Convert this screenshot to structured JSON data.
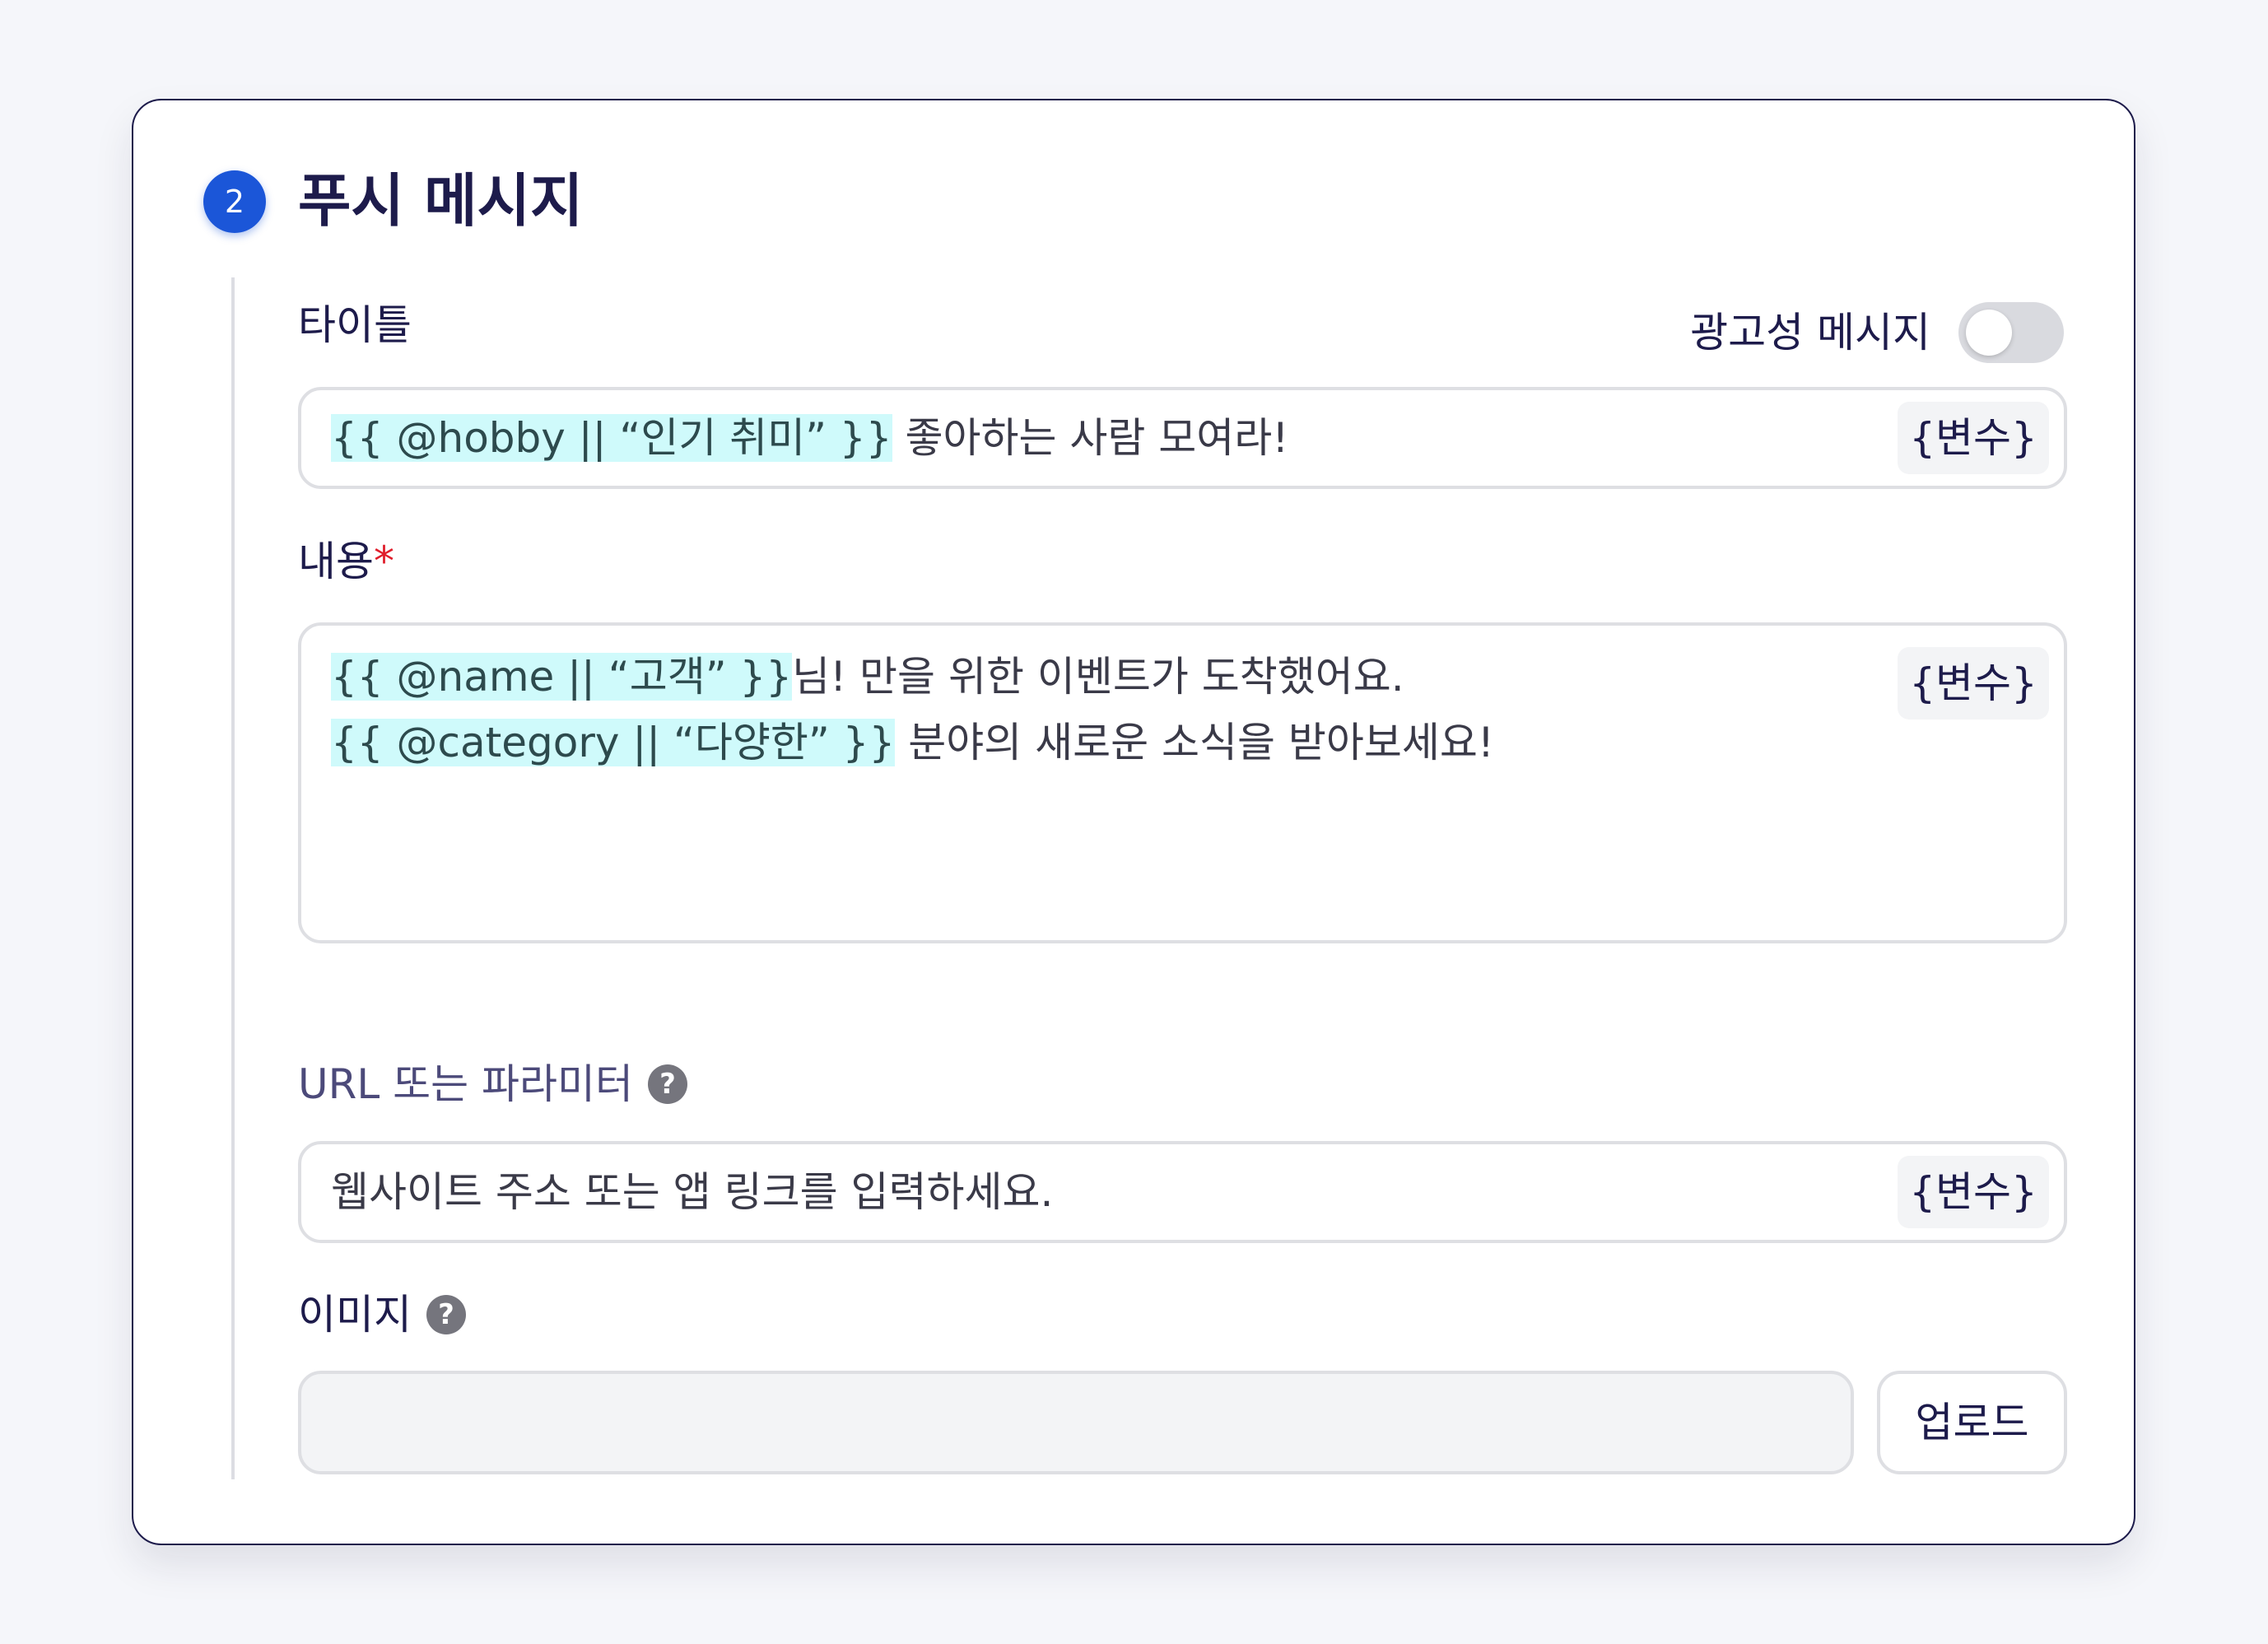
{
  "section": {
    "step_number": "2",
    "title": "푸시 메시지"
  },
  "title_field": {
    "label": "타이틀",
    "variable_chip": "{{ @hobby || “인기 취미” }}",
    "text": " 좋아하는 사람 모여라!",
    "variable_button": "{변수}"
  },
  "ad_toggle": {
    "label": "광고성 메시지",
    "on": false
  },
  "content_field": {
    "label": "내용",
    "required_mark": "*",
    "line1_chip": "{{ @name || “고객” }}",
    "line1_text": "님! 만을 위한 이벤트가 도착했어요.",
    "line2_chip": "{{ @category || “다양한” }}",
    "line2_text": " 분야의 새로운 소식을 받아보세요!",
    "variable_button": "{변수}"
  },
  "url_field": {
    "label": "URL 또는 파라미터",
    "help_icon": "question-circle-icon",
    "placeholder": "웹사이트 주소 또는 앱 링크를 입력하세요.",
    "variable_button": "{변수}"
  },
  "image_field": {
    "label": "이미지",
    "help_icon": "question-circle-icon",
    "upload_button": "업로드"
  },
  "colors": {
    "accent": "#1b56d8",
    "title": "#1d1b4b",
    "variable_highlight": "#cffafb",
    "required": "#e01e2b"
  }
}
